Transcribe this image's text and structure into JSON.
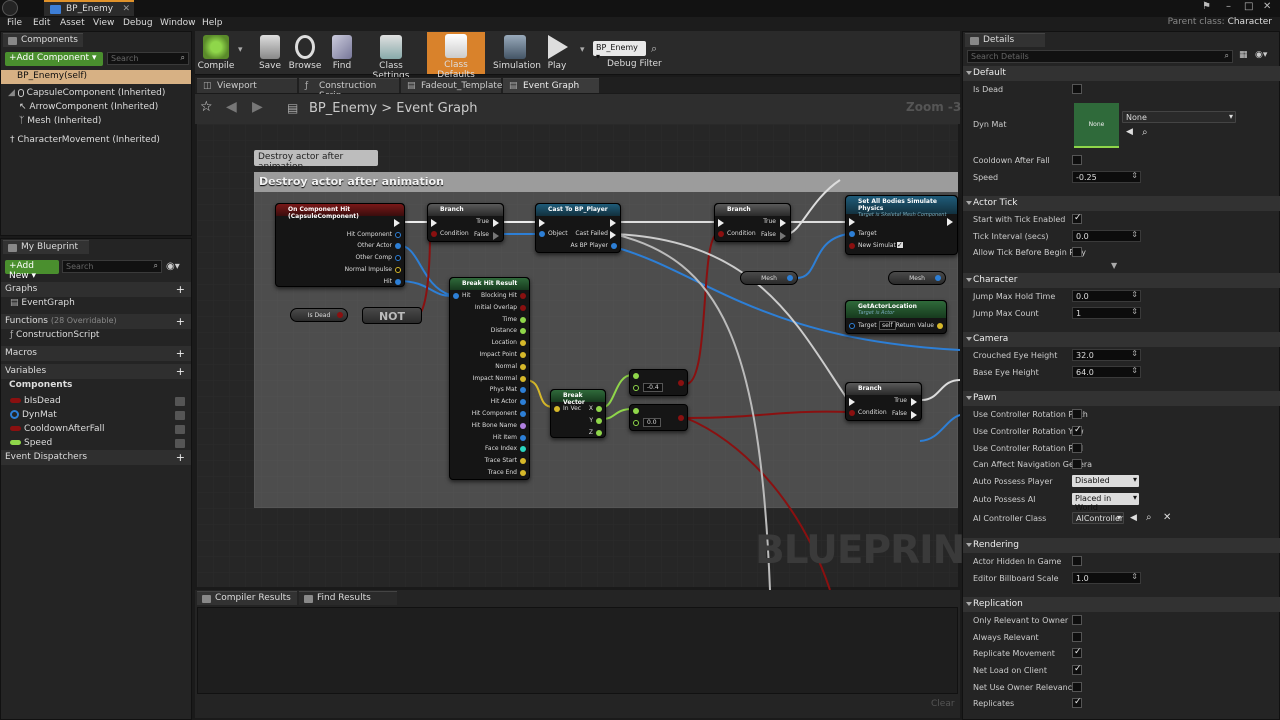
{
  "window": {
    "tab_title": "BP_Enemy",
    "parent_class_label": "Parent class:",
    "parent_class_value": "Character"
  },
  "menu": [
    "File",
    "Edit",
    "Asset",
    "View",
    "Debug",
    "Window",
    "Help"
  ],
  "components_panel": {
    "tab": "Components",
    "add_button": "+Add Component ▾",
    "search_placeholder": "Search",
    "items": [
      {
        "label": "BP_Enemy(self)",
        "selected": true
      },
      {
        "label": "CapsuleComponent (Inherited)"
      },
      {
        "label": "ArrowComponent (Inherited)"
      },
      {
        "label": "Mesh (Inherited)"
      },
      {
        "label": "CharacterMovement (Inherited)"
      }
    ]
  },
  "my_blueprint": {
    "tab": "My Blueprint",
    "add_new": "+Add New ▾",
    "search_placeholder": "Search",
    "graphs_label": "Graphs",
    "graphs_item": "EventGraph",
    "functions_label": "Functions",
    "functions_note": "(28 Overridable)",
    "functions_item": "ConstructionScript",
    "macros_label": "Macros",
    "variables_label": "Variables",
    "components_label": "Components",
    "variables": [
      {
        "name": "bIsDead",
        "color": "#8a1010"
      },
      {
        "name": "DynMat",
        "color": "#2d7fd6"
      },
      {
        "name": "CooldownAfterFall",
        "color": "#8a1010"
      },
      {
        "name": "Speed",
        "color": "#8fd64a"
      }
    ],
    "dispatchers_label": "Event Dispatchers"
  },
  "toolbar": {
    "compile": "Compile",
    "save": "Save",
    "browse": "Browse",
    "find": "Find",
    "class_settings": "Class Settings",
    "class_defaults": "Class Defaults",
    "simulation": "Simulation",
    "play": "Play",
    "debug_select": "BP_Enemy",
    "debug_filter": "Debug Filter"
  },
  "graph_tabs": [
    "Viewport",
    "Construction Scrip",
    "Fadeout_Template",
    "Event Graph"
  ],
  "breadcrumb": {
    "root": "BP_Enemy",
    "sep": ">",
    "leaf": "Event Graph"
  },
  "zoom": "Zoom -3",
  "comment": {
    "bubble": "Destroy actor after animation",
    "title": "Destroy actor after animation"
  },
  "watermark": "BLUEPRINT",
  "nodes": {
    "on_hit": {
      "title": "On Component Hit (CapsuleComponent)",
      "pins": [
        "Hit Component",
        "Other Actor",
        "Other Comp",
        "Normal Impulse",
        "Hit"
      ]
    },
    "branch1": {
      "title": "Branch",
      "condition": "Condition",
      "true": "True",
      "false": "False"
    },
    "cast": {
      "title": "Cast To BP_Player",
      "object": "Object",
      "cast_failed": "Cast Failed",
      "as": "As BP Player"
    },
    "branch2": {
      "title": "Branch",
      "condition": "Condition",
      "true": "True",
      "false": "False"
    },
    "simulate": {
      "title": "Set All Bodies Simulate Physics",
      "subtitle": "Target is Skeletal Mesh Component",
      "target": "Target",
      "new_sim": "New Simulate"
    },
    "mesh1": "Mesh",
    "mesh2": "Mesh",
    "get_actor_loc": {
      "title": "GetActorLocation",
      "subtitle": "Target is Actor",
      "target": "Target",
      "self": "self",
      "return": "Return Value"
    },
    "is_dead": "Is Dead",
    "not": "NOT",
    "break_hit": {
      "title": "Break Hit Result",
      "hit": "Hit",
      "pins": [
        "Blocking Hit",
        "Initial Overlap",
        "Time",
        "Distance",
        "Location",
        "Impact Point",
        "Normal",
        "Impact Normal",
        "Phys Mat",
        "Hit Actor",
        "Hit Component",
        "Hit Bone Name",
        "Hit Item",
        "Face Index",
        "Trace Start",
        "Trace End"
      ]
    },
    "break_vec": {
      "title": "Break Vector",
      "in": "In Vec",
      "x": "X",
      "y": "Y",
      "z": "Z"
    },
    "cmp1": "-0.4",
    "cmp2": "0.0",
    "branch3": {
      "title": "Branch",
      "condition": "Condition",
      "true": "True",
      "false": "False"
    }
  },
  "bottom_tabs": [
    "Compiler Results",
    "Find Results"
  ],
  "clear": "Clear",
  "details": {
    "tab": "Details",
    "search_placeholder": "Search Details",
    "sections": {
      "default": "Default",
      "actor_tick": "Actor Tick",
      "character": "Character",
      "camera": "Camera",
      "pawn": "Pawn",
      "rendering": "Rendering",
      "replication": "Replication"
    },
    "is_dead": "Is Dead",
    "dyn_mat": "Dyn Mat",
    "dyn_mat_thumb": "None",
    "dyn_mat_value": "None",
    "cooldown": "Cooldown After Fall",
    "speed": "Speed",
    "speed_value": "-0.25",
    "start_tick": "Start with Tick Enabled",
    "tick_interval": "Tick Interval (secs)",
    "tick_interval_value": "0.0",
    "allow_tick": "Allow Tick Before Begin Play",
    "jump_hold": "Jump Max Hold Time",
    "jump_hold_value": "0.0",
    "jump_count": "Jump Max Count",
    "jump_count_value": "1",
    "crouched_eye": "Crouched Eye Height",
    "crouched_eye_value": "32.0",
    "base_eye": "Base Eye Height",
    "base_eye_value": "64.0",
    "use_pitch": "Use Controller Rotation Pitch",
    "use_yaw": "Use Controller Rotation Yaw",
    "use_roll": "Use Controller Rotation Roll",
    "can_affect_nav": "Can Affect Navigation Genera",
    "auto_possess_player": "Auto Possess Player",
    "auto_possess_player_value": "Disabled",
    "auto_possess_ai": "Auto Possess AI",
    "auto_possess_ai_value": "Placed in World",
    "ai_controller": "AI Controller Class",
    "ai_controller_value": "AIController",
    "hidden_in_game": "Actor Hidden In Game",
    "billboard_scale": "Editor Billboard Scale",
    "billboard_scale_value": "1.0",
    "only_relevant": "Only Relevant to Owner",
    "always_relevant": "Always Relevant",
    "replicate_movement": "Replicate Movement",
    "net_load": "Net Load on Client",
    "net_owner": "Net Use Owner Relevancy",
    "replicates": "Replicates"
  }
}
